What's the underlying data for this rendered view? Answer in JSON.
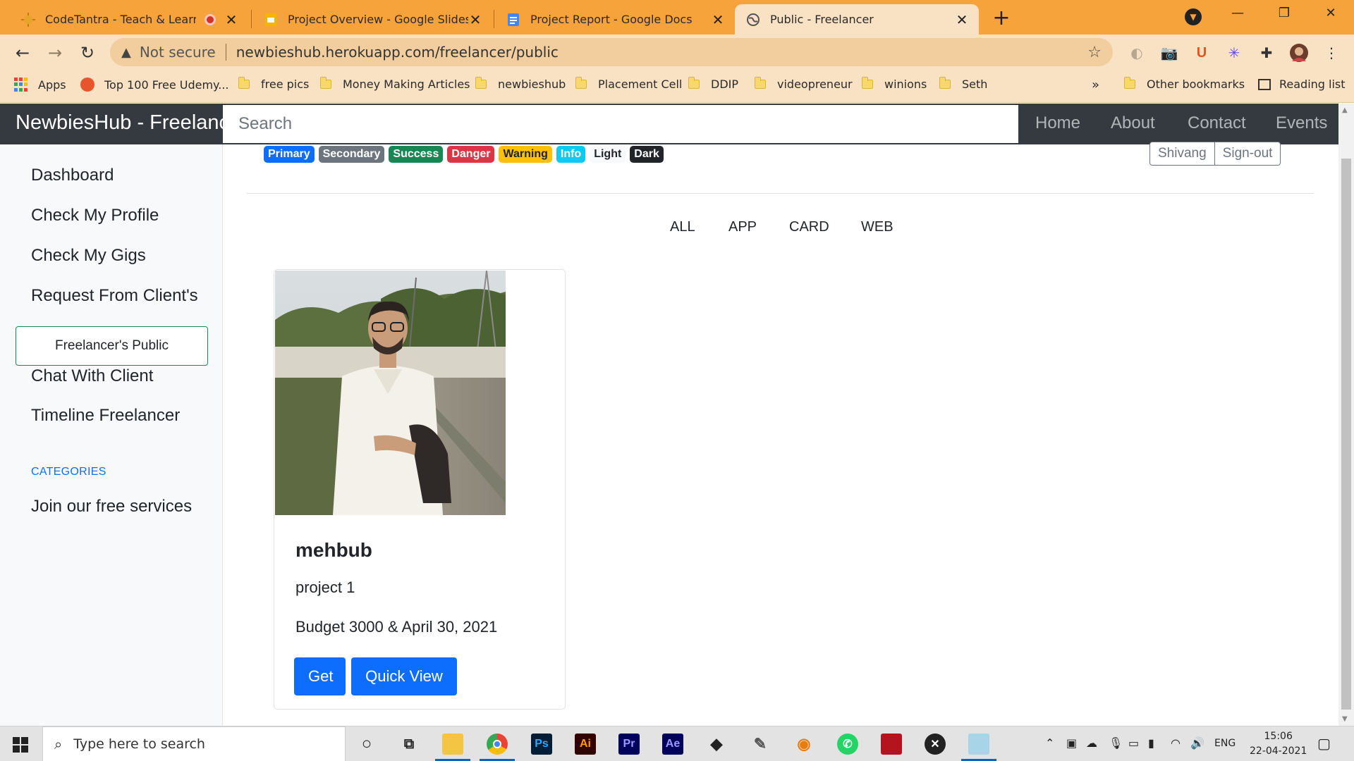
{
  "tabs": [
    {
      "title": "CodeTantra - Teach & Learn An",
      "icon": "codetantra-icon"
    },
    {
      "title": "Project Overview - Google Slides",
      "icon": "slides-icon"
    },
    {
      "title": "Project Report - Google Docs",
      "icon": "docs-icon"
    },
    {
      "title": "Public - Freelancer",
      "icon": "globe-icon",
      "active": true
    }
  ],
  "address": {
    "security": "Not secure",
    "url": "newbieshub.herokuapp.com/freelancer/public"
  },
  "bookmarks": [
    {
      "label": "Apps"
    },
    {
      "label": "Top 100 Free Udemy..."
    },
    {
      "label": "free pics"
    },
    {
      "label": "Money Making Articles"
    },
    {
      "label": "newbieshub"
    },
    {
      "label": "Placement Cell"
    },
    {
      "label": "DDIP"
    },
    {
      "label": "videopreneur"
    },
    {
      "label": "winions"
    },
    {
      "label": "Seth"
    }
  ],
  "bookmarks_overflow": "»",
  "other_bookmarks": "Other bookmarks",
  "reading_list": "Reading list",
  "site": {
    "brand": "NewbiesHub - Freelancer",
    "search_placeholder": "Search",
    "nav": [
      "Home",
      "About",
      "Contact",
      "Events"
    ]
  },
  "sidebar": {
    "items": [
      "Dashboard",
      "Check My Profile",
      "Check My Gigs",
      "Request From Client's"
    ],
    "active": "Freelancer's Public",
    "items_after": [
      "Chat With Client",
      "Timeline Freelancer"
    ],
    "heading": "CATEGORIES",
    "category_items": [
      "Join our free services"
    ]
  },
  "badges": [
    {
      "label": "Primary",
      "color": "#0d6efd",
      "text": "#ffffff"
    },
    {
      "label": "Secondary",
      "color": "#6c757d",
      "text": "#ffffff"
    },
    {
      "label": "Success",
      "color": "#198754",
      "text": "#ffffff"
    },
    {
      "label": "Danger",
      "color": "#dc3545",
      "text": "#ffffff"
    },
    {
      "label": "Warning",
      "color": "#ffc107",
      "text": "#212529"
    },
    {
      "label": "Info",
      "color": "#0dcaf0",
      "text": "#ffffff"
    },
    {
      "label": "Light",
      "color": "#f8f9fa",
      "text": "#212529"
    },
    {
      "label": "Dark",
      "color": "#212529",
      "text": "#ffffff"
    }
  ],
  "user": {
    "name": "Shivang",
    "signout": "Sign-out"
  },
  "filters": [
    "ALL",
    "APP",
    "CARD",
    "WEB"
  ],
  "card": {
    "name": "mehbub",
    "project": "project 1",
    "budget_line": "Budget 3000 & April 30, 2021",
    "get_label": "Get",
    "quick_view_label": "Quick View"
  },
  "taskbar": {
    "search_placeholder": "Type here to search",
    "language": "ENG",
    "time": "15:06",
    "date": "22-04-2021"
  },
  "colors": {
    "tabstrip": "#f7a33b",
    "toolbar": "#f9e2c4",
    "navbar": "#343a40",
    "primary": "#0d6efd"
  }
}
